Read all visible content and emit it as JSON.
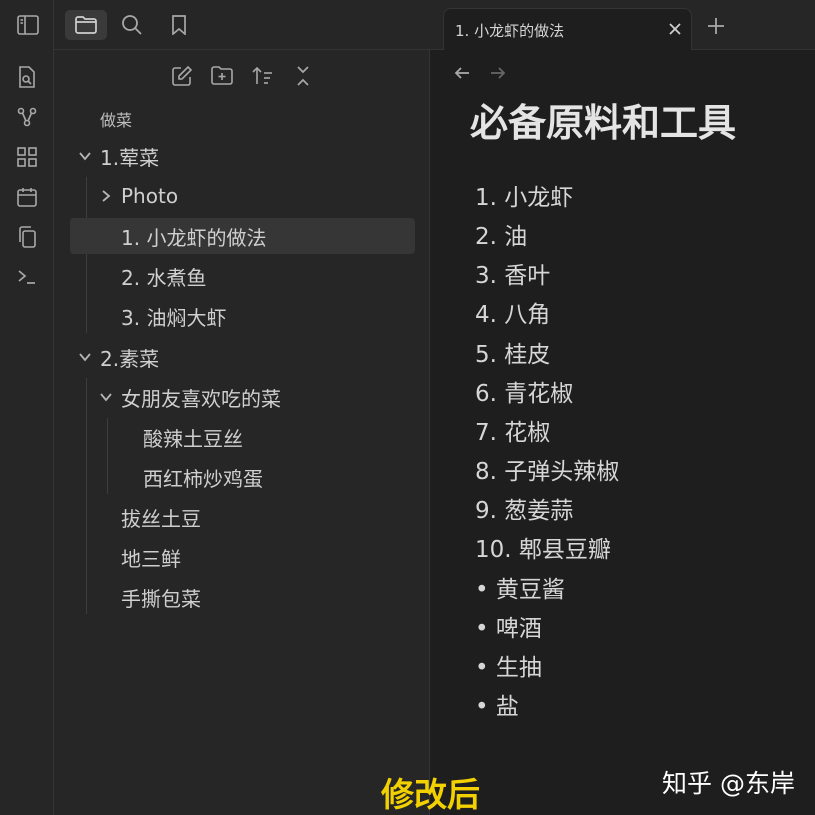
{
  "sidebar": {
    "root_label": "做菜",
    "tree": {
      "folder_1": "1.荤菜",
      "photo": "Photo",
      "file_1": "1. 小龙虾的做法",
      "file_2": "2. 水煮鱼",
      "file_3": "3. 油焖大虾",
      "folder_2": "2.素菜",
      "subfolder": "女朋友喜欢吃的菜",
      "sub_1": "酸辣土豆丝",
      "sub_2": "西红柿炒鸡蛋",
      "f_a": "拔丝土豆",
      "f_b": "地三鲜",
      "f_c": "手撕包菜"
    }
  },
  "tab": {
    "title": "1. 小龙虾的做法"
  },
  "doc": {
    "title": "必备原料和工具",
    "items": [
      "1. 小龙虾",
      "2. 油",
      "3. 香叶",
      "4. 八角",
      "5. 桂皮",
      "6. 青花椒",
      "7. 花椒",
      "8. 子弹头辣椒",
      "9. 葱姜蒜",
      "10. 郫县豆瓣",
      "• 黄豆酱",
      "• 啤酒",
      "• 生抽",
      "• 盐"
    ]
  },
  "caption": "修改后",
  "watermark": "知乎 @东岸"
}
